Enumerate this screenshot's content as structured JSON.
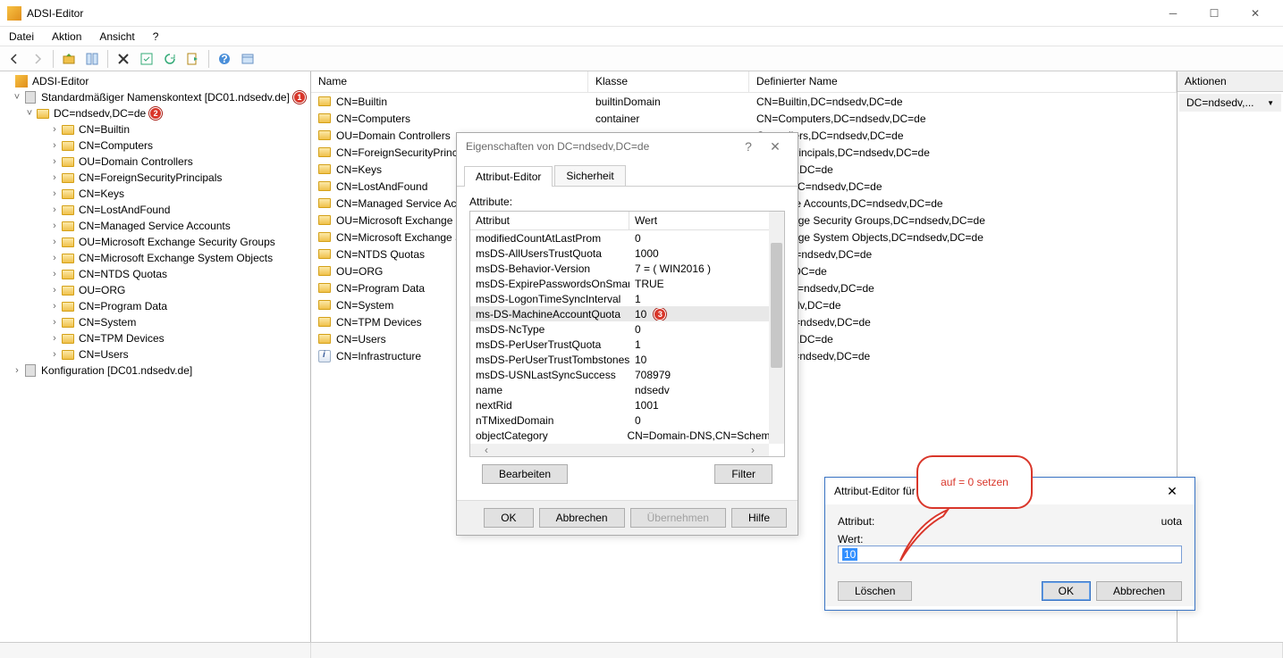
{
  "window": {
    "title": "ADSI-Editor"
  },
  "menu": {
    "file": "Datei",
    "action": "Aktion",
    "view": "Ansicht",
    "help": "?"
  },
  "tree": {
    "root": "ADSI-Editor",
    "context": "Standardmäßiger Namenskontext [DC01.ndsedv.de]",
    "dc": "DC=ndsedv,DC=de",
    "nodes": [
      "CN=Builtin",
      "CN=Computers",
      "OU=Domain Controllers",
      "CN=ForeignSecurityPrincipals",
      "CN=Keys",
      "CN=LostAndFound",
      "CN=Managed Service Accounts",
      "OU=Microsoft Exchange Security Groups",
      "CN=Microsoft Exchange System Objects",
      "CN=NTDS Quotas",
      "OU=ORG",
      "CN=Program Data",
      "CN=System",
      "CN=TPM Devices",
      "CN=Users"
    ],
    "config": "Konfiguration [DC01.ndsedv.de]"
  },
  "list": {
    "cols": {
      "name": "Name",
      "class": "Klasse",
      "dn": "Definierter Name"
    },
    "rows": [
      {
        "name": "CN=Builtin",
        "class": "builtinDomain",
        "dn": "CN=Builtin,DC=ndsedv,DC=de",
        "icon": "folder"
      },
      {
        "name": "CN=Computers",
        "class": "container",
        "dn": "CN=Computers,DC=ndsedv,DC=de",
        "icon": "folder"
      },
      {
        "name": "OU=Domain Controllers",
        "class": "",
        "dn": "Controllers,DC=ndsedv,DC=de",
        "icon": "folder"
      },
      {
        "name": "CN=ForeignSecurityPrincipals",
        "class": "",
        "dn": "ecurityPrincipals,DC=ndsedv,DC=de",
        "icon": "folder"
      },
      {
        "name": "CN=Keys",
        "class": "",
        "dn": "=ndsedv,DC=de",
        "icon": "folder"
      },
      {
        "name": "CN=LostAndFound",
        "class": "",
        "dn": "Found,DC=ndsedv,DC=de",
        "icon": "folder"
      },
      {
        "name": "CN=Managed Service Accounts",
        "class": "",
        "dn": "d Service Accounts,DC=ndsedv,DC=de",
        "icon": "folder"
      },
      {
        "name": "OU=Microsoft Exchange Security Groups",
        "class": "",
        "dn": "t Exchange Security Groups,DC=ndsedv,DC=de",
        "icon": "folder"
      },
      {
        "name": "CN=Microsoft Exchange System Objects",
        "class": "",
        "dn": "t Exchange System Objects,DC=ndsedv,DC=de",
        "icon": "folder"
      },
      {
        "name": "CN=NTDS Quotas",
        "class": "",
        "dn": "otas,DC=ndsedv,DC=de",
        "icon": "folder"
      },
      {
        "name": "OU=ORG",
        "class": "",
        "dn": "ndsedv,DC=de",
        "icon": "folder"
      },
      {
        "name": "CN=Program Data",
        "class": "",
        "dn": "Data,DC=ndsedv,DC=de",
        "icon": "folder"
      },
      {
        "name": "CN=System",
        "class": "",
        "dn": "C=ndsedv,DC=de",
        "icon": "folder"
      },
      {
        "name": "CN=TPM Devices",
        "class": "",
        "dn": "ices,DC=ndsedv,DC=de",
        "icon": "folder"
      },
      {
        "name": "CN=Users",
        "class": "",
        "dn": "=ndsedv,DC=de",
        "icon": "folder"
      },
      {
        "name": "CN=Infrastructure",
        "class": "",
        "dn": "ture,DC=ndsedv,DC=de",
        "icon": "info"
      }
    ]
  },
  "actions": {
    "title": "Aktionen",
    "item": "DC=ndsedv,..."
  },
  "props": {
    "title": "Eigenschaften von DC=ndsedv,DC=de",
    "tab1": "Attribut-Editor",
    "tab2": "Sicherheit",
    "label": "Attribute:",
    "col1": "Attribut",
    "col2": "Wert",
    "rows": [
      {
        "a": "modifiedCountAtLastProm",
        "v": "0"
      },
      {
        "a": "msDS-AllUsersTrustQuota",
        "v": "1000"
      },
      {
        "a": "msDS-Behavior-Version",
        "v": "7 = ( WIN2016 )"
      },
      {
        "a": "msDS-ExpirePasswordsOnSmartC...",
        "v": "TRUE"
      },
      {
        "a": "msDS-LogonTimeSyncInterval",
        "v": "1"
      },
      {
        "a": "ms-DS-MachineAccountQuota",
        "v": "10",
        "sel": true,
        "badge": "3"
      },
      {
        "a": "msDS-NcType",
        "v": "0"
      },
      {
        "a": "msDS-PerUserTrustQuota",
        "v": "1"
      },
      {
        "a": "msDS-PerUserTrustTombstonesQ...",
        "v": "10"
      },
      {
        "a": "msDS-USNLastSyncSuccess",
        "v": "708979"
      },
      {
        "a": "name",
        "v": "ndsedv"
      },
      {
        "a": "nextRid",
        "v": "1001"
      },
      {
        "a": "nTMixedDomain",
        "v": "0"
      },
      {
        "a": "objectCategory",
        "v": "CN=Domain-DNS,CN=Schema,C"
      }
    ],
    "edit": "Bearbeiten",
    "filter": "Filter",
    "ok": "OK",
    "cancel": "Abbrechen",
    "apply": "Übernehmen",
    "help": "Hilfe"
  },
  "attr_dlg": {
    "title": "Attribut-Editor für",
    "attr_suffix": "uota",
    "attr_label": "Attribut:",
    "val_label": "Wert:",
    "value": "10",
    "clear": "Löschen",
    "ok": "OK",
    "cancel": "Abbrechen"
  },
  "callout": "auf = 0 setzen",
  "badges": {
    "one": "1",
    "two": "2",
    "three": "3"
  }
}
